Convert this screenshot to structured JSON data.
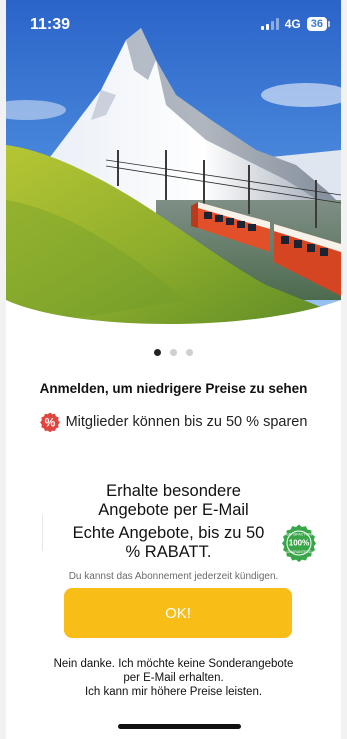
{
  "status_bar": {
    "time": "11:39",
    "network": "4G",
    "battery": "36"
  },
  "hero": {
    "image_description_icon": "matterhorn-train-photo",
    "carousel": {
      "pages": 3,
      "active_index": 0
    }
  },
  "login": {
    "title": "Anmelden, um niedrigere Preise zu sehen",
    "members_text": "Mitglieder können bis zu 50 % sparen",
    "members_icon": "percent-badge-icon"
  },
  "offer": {
    "title_line1": "Erhalte besondere",
    "title_line2": "Angebote per E-Mail",
    "sub_line1": "Echte Angebote, bis zu 50",
    "sub_line2": "% RABATT.",
    "seal_text_top": "SATISFACTION",
    "seal_text_center": "100%",
    "seal_text_bottom": "GUARANTEED",
    "cancel_note": "Du kannst das Abonnement jederzeit kündigen."
  },
  "actions": {
    "ok_label": "OK!",
    "decline_line1": "Nein danke. Ich möchte keine Sonderangebote",
    "decline_line2": "per E-Mail erhalten.",
    "decline_line3": "Ich kann mir höhere Preise leisten."
  },
  "colors": {
    "accent_button": "#f8bd17",
    "badge_red": "#e0463f",
    "seal_green": "#3aa64a"
  }
}
